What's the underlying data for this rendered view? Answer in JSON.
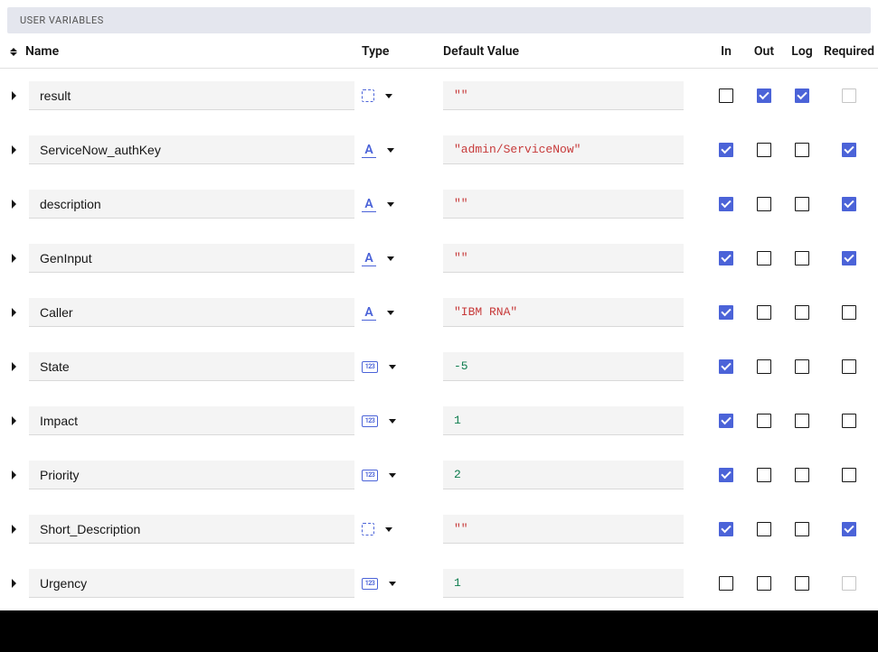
{
  "section_title": "USER VARIABLES",
  "columns": {
    "name": "Name",
    "type": "Type",
    "default": "Default Value",
    "in": "In",
    "out": "Out",
    "log": "Log",
    "required": "Required"
  },
  "type_icons": {
    "any": "any",
    "string": "A",
    "number": "123"
  },
  "rows": [
    {
      "name": "result",
      "type": "any",
      "default": "\"\"",
      "default_kind": "string",
      "in": false,
      "out": true,
      "log": true,
      "required": false,
      "required_style": "light"
    },
    {
      "name": "ServiceNow_authKey",
      "type": "string",
      "default": "\"admin/ServiceNow\"",
      "default_kind": "string",
      "in": true,
      "out": false,
      "log": false,
      "required": true,
      "required_style": "dark"
    },
    {
      "name": "description",
      "type": "string",
      "default": "\"\"",
      "default_kind": "string",
      "in": true,
      "out": false,
      "log": false,
      "required": true,
      "required_style": "dark"
    },
    {
      "name": "GenInput",
      "type": "string",
      "default": "\"\"",
      "default_kind": "string",
      "in": true,
      "out": false,
      "log": false,
      "required": true,
      "required_style": "dark"
    },
    {
      "name": "Caller",
      "type": "string",
      "default": "\"IBM RNA\"",
      "default_kind": "string",
      "in": true,
      "out": false,
      "log": false,
      "required": false,
      "required_style": "dark"
    },
    {
      "name": "State",
      "type": "number",
      "default": "-5",
      "default_kind": "number",
      "in": true,
      "out": false,
      "log": false,
      "required": false,
      "required_style": "dark"
    },
    {
      "name": "Impact",
      "type": "number",
      "default": "1",
      "default_kind": "number",
      "in": true,
      "out": false,
      "log": false,
      "required": false,
      "required_style": "dark"
    },
    {
      "name": "Priority",
      "type": "number",
      "default": "2",
      "default_kind": "number",
      "in": true,
      "out": false,
      "log": false,
      "required": false,
      "required_style": "dark"
    },
    {
      "name": "Short_Description",
      "type": "any",
      "default": "\"\"",
      "default_kind": "string",
      "in": true,
      "out": false,
      "log": false,
      "required": true,
      "required_style": "dark"
    },
    {
      "name": "Urgency",
      "type": "number",
      "default": "1",
      "default_kind": "number",
      "in": false,
      "out": false,
      "log": false,
      "required": false,
      "required_style": "light"
    }
  ]
}
